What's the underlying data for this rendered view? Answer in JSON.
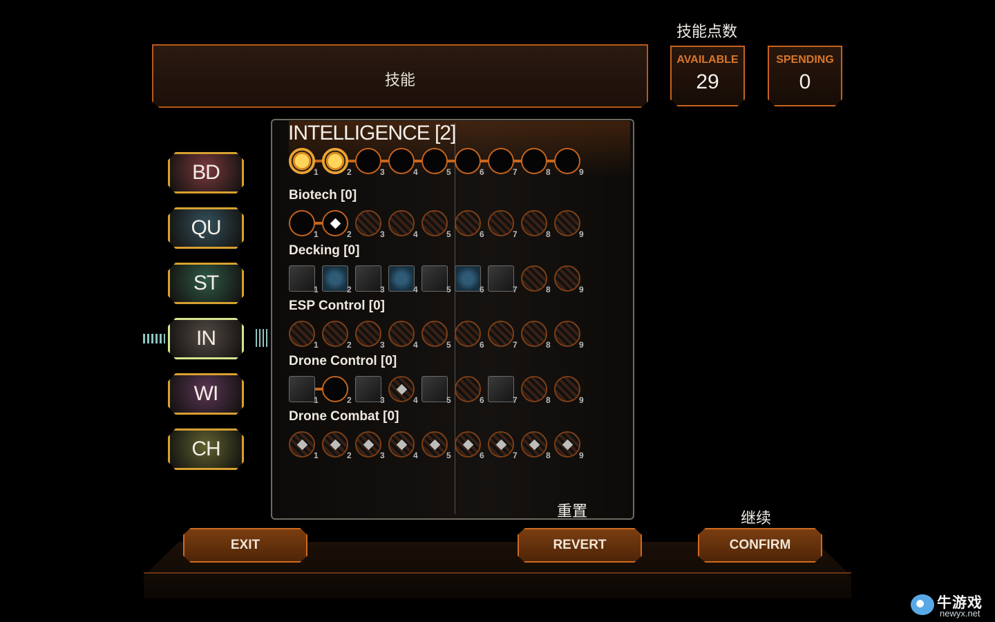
{
  "header": {
    "title": "技能"
  },
  "skill_points": {
    "caption": "技能点数",
    "available_label": "AVAILABLE",
    "available_value": "29",
    "spending_label": "SPENDING",
    "spending_value": "0"
  },
  "attributes": [
    {
      "code": "BD",
      "color": "#7a3a3e"
    },
    {
      "code": "QU",
      "color": "#33515c"
    },
    {
      "code": "ST",
      "color": "#2f5a46"
    },
    {
      "code": "IN",
      "color": "#514a45",
      "active": true
    },
    {
      "code": "WI",
      "color": "#5a3554"
    },
    {
      "code": "CH",
      "color": "#5f6330"
    }
  ],
  "panel": {
    "attribute_title": "INTELLIGENCE [2]",
    "skills": [
      {
        "label": "Biotech [0]"
      },
      {
        "label": "Decking [0]"
      },
      {
        "label": "ESP Control [0]"
      },
      {
        "label": "Drone Control [0]"
      },
      {
        "label": "Drone Combat [0]"
      }
    ],
    "node_numbers": [
      "1",
      "2",
      "3",
      "4",
      "5",
      "6",
      "7",
      "8",
      "9"
    ]
  },
  "buttons": {
    "exit": "EXIT",
    "revert": "REVERT",
    "confirm": "CONFIRM",
    "revert_caption": "重置",
    "confirm_caption": "继续"
  },
  "watermark": {
    "main": "牛游戏",
    "sub": "newyx.net"
  }
}
